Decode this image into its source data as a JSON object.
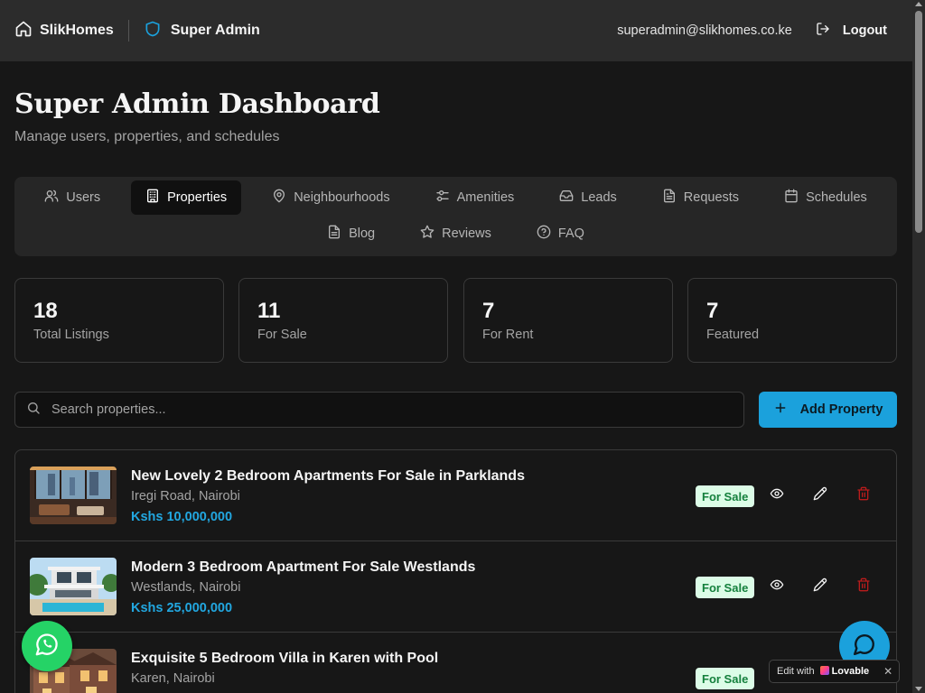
{
  "topbar": {
    "brand": "SlikHomes",
    "role": "Super Admin",
    "email": "superadmin@slikhomes.co.ke",
    "logout": "Logout"
  },
  "header": {
    "title": "Super Admin Dashboard",
    "subtitle": "Manage users, properties, and schedules"
  },
  "tabs": [
    {
      "label": "Users",
      "icon": "users-icon",
      "active": false
    },
    {
      "label": "Properties",
      "icon": "building-icon",
      "active": true
    },
    {
      "label": "Neighbourhoods",
      "icon": "map-pin-icon",
      "active": false
    },
    {
      "label": "Amenities",
      "icon": "sliders-icon",
      "active": false
    },
    {
      "label": "Leads",
      "icon": "inbox-icon",
      "active": false
    },
    {
      "label": "Requests",
      "icon": "file-text-icon",
      "active": false
    },
    {
      "label": "Schedules",
      "icon": "calendar-icon",
      "active": false
    },
    {
      "label": "Blog",
      "icon": "file-icon",
      "active": false
    },
    {
      "label": "Reviews",
      "icon": "star-icon",
      "active": false
    },
    {
      "label": "FAQ",
      "icon": "help-circle-icon",
      "active": false
    }
  ],
  "stats": [
    {
      "value": "18",
      "label": "Total Listings"
    },
    {
      "value": "11",
      "label": "For Sale"
    },
    {
      "value": "7",
      "label": "For Rent"
    },
    {
      "value": "7",
      "label": "Featured"
    }
  ],
  "search": {
    "placeholder": "Search properties..."
  },
  "add_button": "Add Property",
  "properties": [
    {
      "title": "New Lovely 2 Bedroom Apartments For Sale in Parklands",
      "location": "Iregi Road, Nairobi",
      "price": "Kshs 10,000,000",
      "status": "For Sale"
    },
    {
      "title": "Modern 3 Bedroom Apartment For Sale Westlands",
      "location": "Westlands, Nairobi",
      "price": "Kshs 25,000,000",
      "status": "For Sale"
    },
    {
      "title": "Exquisite 5 Bedroom Villa in Karen with Pool",
      "location": "Karen, Nairobi",
      "price": "",
      "status": "For Sale"
    }
  ],
  "lovable": {
    "prefix": "Edit with",
    "brand": "Lovable",
    "close": "✕"
  },
  "colors": {
    "accent": "#1ba1dc",
    "badge_bg": "#dcfce7",
    "badge_text": "#15803d",
    "delete": "#b91c1c",
    "whatsapp": "#25d366"
  }
}
